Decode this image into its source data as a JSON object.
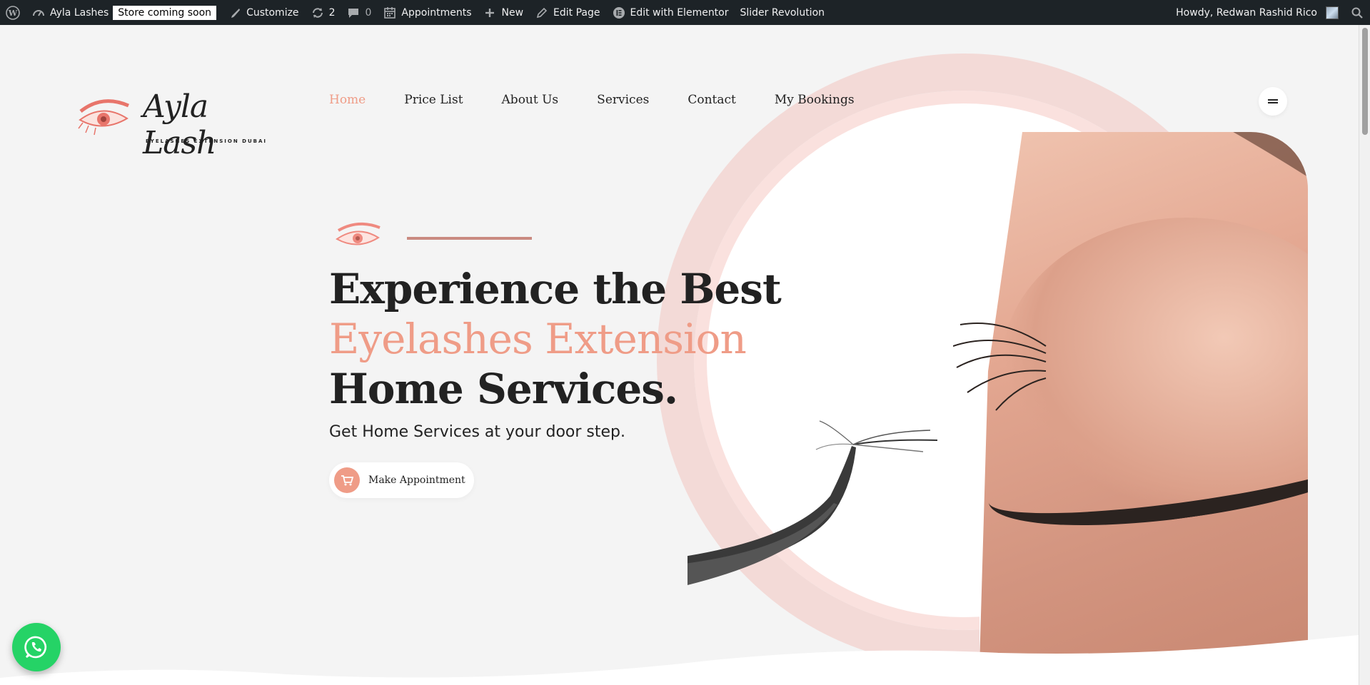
{
  "adminbar": {
    "site_name": "Ayla Lashes",
    "coming_soon": "Store coming soon",
    "customize": "Customize",
    "updates_count": "2",
    "comments_count": "0",
    "appointments": "Appointments",
    "new": "New",
    "edit_page": "Edit Page",
    "edit_elementor": "Edit with Elementor",
    "slider_revolution": "Slider Revolution",
    "howdy": "Howdy, Redwan Rashid Rico"
  },
  "logo": {
    "title": "Ayla Lash",
    "subtitle": "EYELASHES EXTENSION DUBAI"
  },
  "nav": {
    "items": [
      {
        "label": "Home",
        "active": true
      },
      {
        "label": "Price List"
      },
      {
        "label": "About Us"
      },
      {
        "label": "Services"
      },
      {
        "label": "Contact"
      },
      {
        "label": "My Bookings"
      }
    ]
  },
  "hero": {
    "line1": "Experience the Best",
    "line2": "Eyelashes Extension",
    "line3": "Home Services.",
    "subhead": "Get Home Services at your door step.",
    "cta_label": "Make Appointment"
  },
  "colors": {
    "accent": "#ef9c87",
    "adminbar": "#1d2327",
    "whatsapp": "#25d366"
  }
}
